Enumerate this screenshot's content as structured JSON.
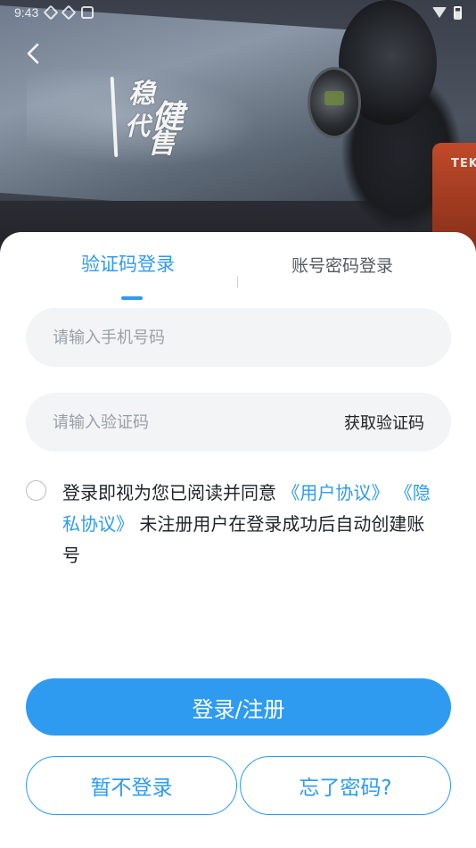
{
  "status_bar": {
    "time": "9:43"
  },
  "hero": {
    "brand_text": "TEKP"
  },
  "logo": {
    "chars": [
      "稳",
      "健",
      "代",
      "售"
    ]
  },
  "tabs": {
    "sms_login": "验证码登录",
    "password_login": "账号密码登录",
    "active": "sms_login"
  },
  "form": {
    "phone_placeholder": "请输入手机号码",
    "code_placeholder": "请输入验证码",
    "get_code_label": "获取验证码"
  },
  "agreement": {
    "prefix": "登录即视为您已阅读并同意",
    "user_agreement": "《用户协议》",
    "privacy_policy": "《隐私协议》",
    "suffix": "未注册用户在登录成功后自动创建账号",
    "checked": false
  },
  "buttons": {
    "login": "登录/注册",
    "skip": "暂不登录",
    "forgot": "忘了密码?"
  },
  "colors": {
    "accent": "#2e9bf0",
    "field_bg": "#f2f4f6",
    "text": "#1f2329"
  }
}
